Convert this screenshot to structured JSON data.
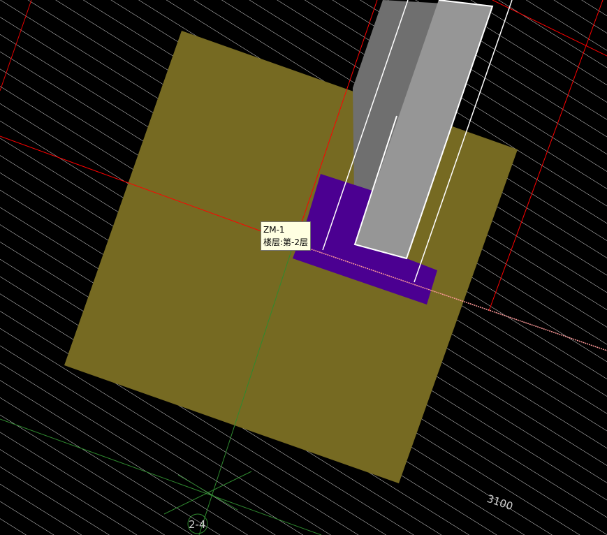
{
  "tooltip": {
    "name": "ZM-1",
    "floor": "楼层:第-2层"
  },
  "labels": {
    "dimension": "3100",
    "axis_label": "2-4"
  },
  "colors": {
    "background": "#000000",
    "hatch": "#d8d8d8",
    "footing": "#766a22",
    "wall_cap": "#4b0091",
    "column_dark": "#6f6f6f",
    "column_light": "#969696",
    "outline": "#ffffff",
    "axis_red": "#ff0000",
    "axis_green": "#2f8a2f"
  }
}
